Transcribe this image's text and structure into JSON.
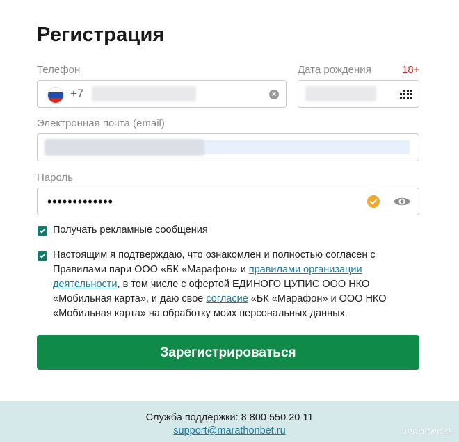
{
  "form": {
    "title": "Регистрация",
    "phone": {
      "label": "Телефон",
      "dial_code": "+7",
      "flag": "russia-flag"
    },
    "birthdate": {
      "label": "Дата рождения",
      "age_badge": "18+"
    },
    "email": {
      "label": "Электронная почта (email)"
    },
    "password": {
      "label": "Пароль",
      "masked_value": "•••••••••••••"
    },
    "ads_checkbox": {
      "label": "Получать рекламные сообщения",
      "checked": true
    },
    "consent_checkbox": {
      "checked": true,
      "text_1": "Настоящим я подтверждаю, что ознакомлен и полностью согласен с Правилами пари ООО «БК «Марафон» и ",
      "link_rules": "правилами организации деятельности",
      "text_2": ", в том числе с офертой ЕДИНОГО ЦУПИС ООО НКО «Мобильная карта», и даю свое ",
      "link_consent": "согласие",
      "text_3": " «БК «Марафон» и ООО НКО «Мобильная карта» на обработку моих персональных данных."
    },
    "submit_label": "Зарегистрироваться"
  },
  "footer": {
    "support_phone": "Служба поддержки: 8 800 550 20 11",
    "support_email": "support@marathonbet.ru"
  },
  "watermark": "VPROGNOZE",
  "colors": {
    "accent_green": "#0f8a48",
    "checkbox_teal": "#127b6a",
    "link": "#1b7b9b",
    "age_red": "#d0312d",
    "footer_bg": "#d6e9ea"
  }
}
